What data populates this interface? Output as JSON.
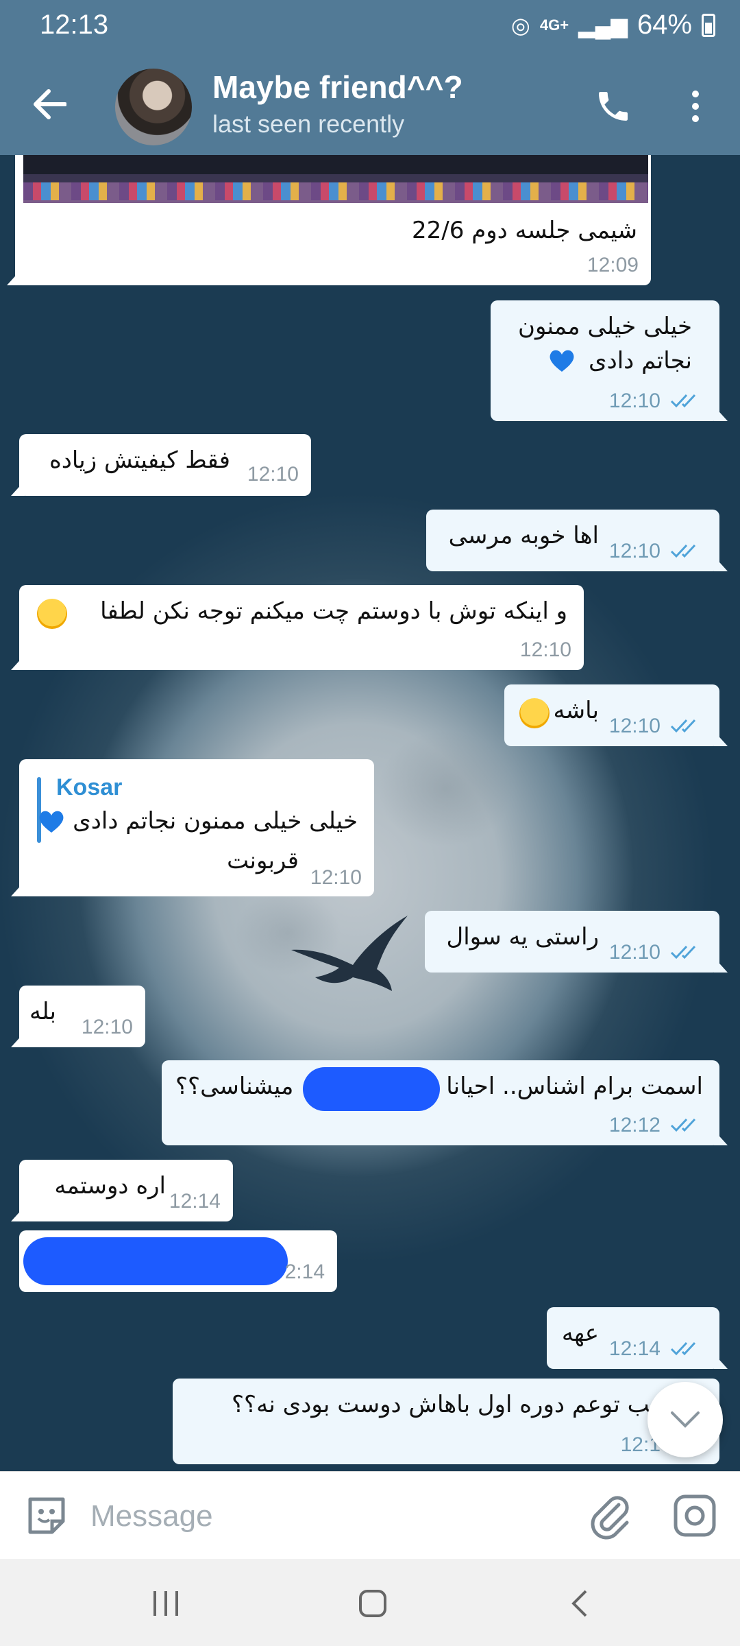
{
  "status_bar": {
    "time": "12:13",
    "network": "4G+",
    "battery": "64%"
  },
  "header": {
    "title": "Maybe friend^^?",
    "subtitle": "last seen recently"
  },
  "messages": [
    {
      "caption": "شیمی جلسه دوم 22/6",
      "time": "12:09"
    },
    {
      "line1": "خیلی خیلی ممنون",
      "line2": "نجاتم دادی",
      "time": "12:10"
    },
    {
      "text": "فقط کیفیتش زیاده",
      "time": "12:10"
    },
    {
      "text": "اها خوبه مرسی",
      "time": "12:10"
    },
    {
      "text": "و اینکه توش با دوستم چت میکنم توجه نکن لطفا",
      "time": "12:10"
    },
    {
      "text": "باشه",
      "time": "12:10"
    },
    {
      "reply_author": "Kosar",
      "reply_text": "خیلی خیلی ممنون نجاتم دادی",
      "text": "قربونت",
      "time": "12:10"
    },
    {
      "text": "راستی یه سوال",
      "time": "12:10"
    },
    {
      "text": "بله",
      "time": "12:10"
    },
    {
      "text_right": "اسمت برام اشناس.. احیانا",
      "text_left": "میشناسی؟؟",
      "time": "12:12"
    },
    {
      "text": "اره دوستمه",
      "time": "12:14"
    },
    {
      "time": "2:14"
    },
    {
      "text": "عهه",
      "time": "12:14"
    },
    {
      "text": "خب توعم دوره اول باهاش دوست بودی نه؟؟",
      "time": "12:1"
    }
  ],
  "input": {
    "placeholder": "Message"
  },
  "colors": {
    "header": "#527a96",
    "accent": "#3a8fd8",
    "outgoing_bubble": "#eef7fd",
    "redaction": "#1d5bff"
  }
}
